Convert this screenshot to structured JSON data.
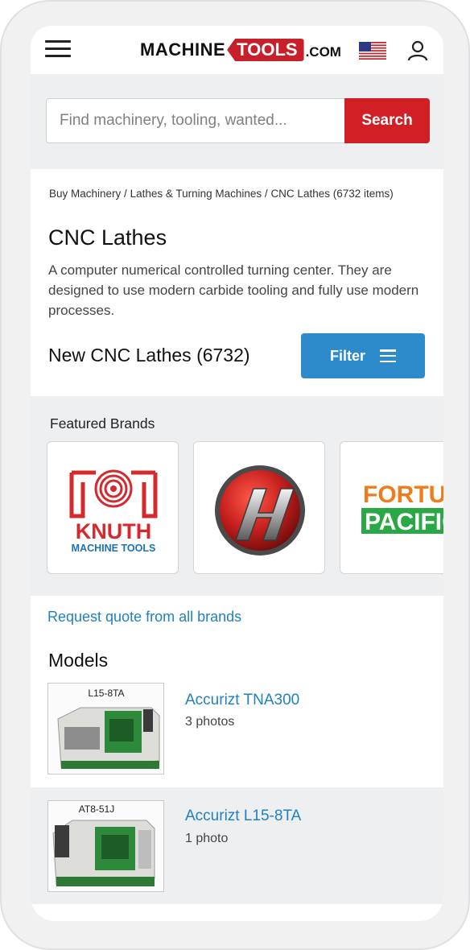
{
  "header": {
    "logo_part1": "MACHINE",
    "logo_part2": "TOOLS",
    "logo_part3": ".COM",
    "logo_accent": "#c8202a"
  },
  "search": {
    "placeholder": "Find machinery, tooling, wanted...",
    "button_label": "Search",
    "button_color": "#d21f26"
  },
  "breadcrumb": {
    "item1": "Buy Machinery",
    "sep": " / ",
    "item2": "Lathes & Turning Machines",
    "item3": "CNC Lathes (6732 items)"
  },
  "category": {
    "title": "CNC Lathes",
    "description": "A computer numerical controlled turning center. They are designed to use modern carbide tooling and fully use modern processes.",
    "new_count_label": "New CNC Lathes (6732)",
    "filter_label": "Filter",
    "filter_color": "#2d8bcb"
  },
  "brands": {
    "title": "Featured Brands",
    "knuth_top": "KNUTH",
    "knuth_bottom": "MACHINE TOOLS",
    "fortune_top": "FORTUNE",
    "fortune_bottom": "PACIFIC"
  },
  "quote_link": "Request quote from all brands",
  "models": {
    "title": "Models",
    "items": [
      {
        "name": "Accurizt TNA300",
        "photos": "3 photos",
        "thumb_label": "L15-8TA"
      },
      {
        "name": "Accurizt L15-8TA",
        "photos": "1 photo",
        "thumb_label": "AT8-51J"
      }
    ]
  }
}
